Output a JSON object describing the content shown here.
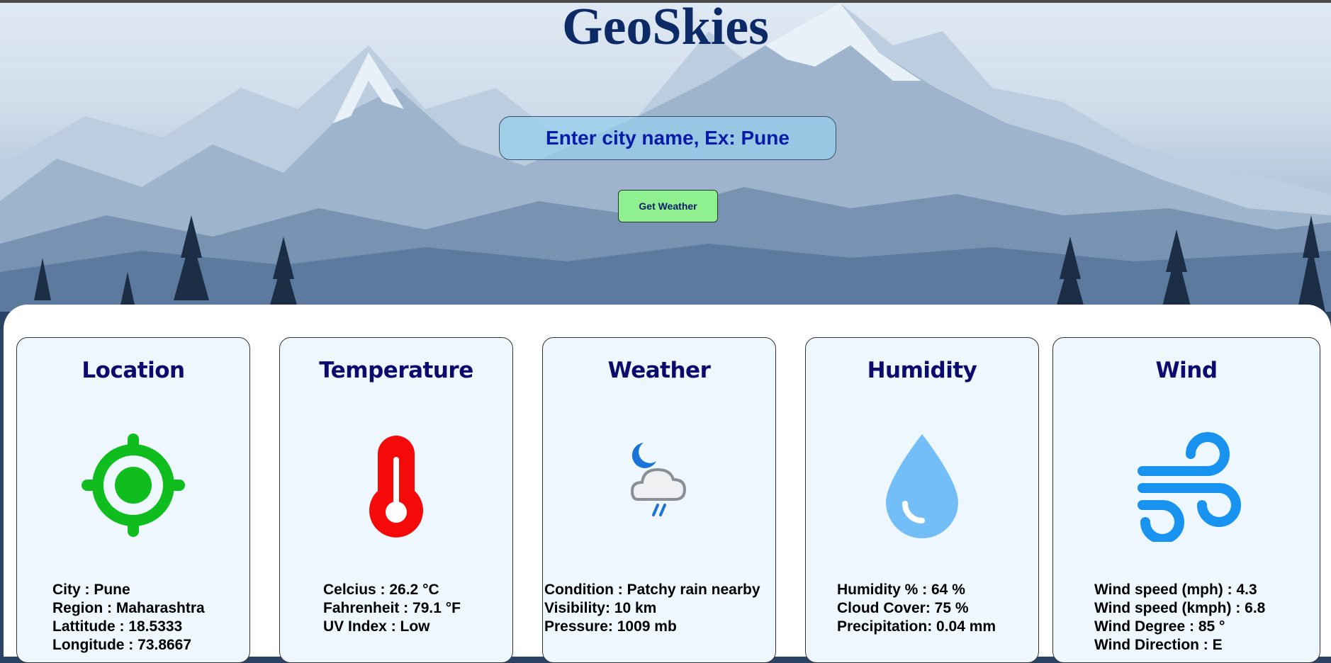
{
  "app": {
    "title": "GeoSkies"
  },
  "search": {
    "placeholder": "Enter city name, Ex: Pune",
    "button_label": "Get Weather"
  },
  "cards": {
    "location": {
      "title": "Location",
      "icon": "location-target-icon",
      "lines": [
        "City : Pune",
        "Region : Maharashtra",
        "Lattitude : 18.5333",
        "Longitude : 73.8667"
      ]
    },
    "temperature": {
      "title": "Temperature",
      "icon": "thermometer-icon",
      "lines": [
        "Celcius : 26.2 °C",
        "Fahrenheit : 79.1 °F",
        "UV Index : Low"
      ]
    },
    "weather": {
      "title": "Weather",
      "icon": "night-cloud-rain-icon",
      "lines": [
        "Condition : Patchy rain nearby",
        "Visibility: 10 km",
        "Pressure: 1009 mb"
      ]
    },
    "humidity": {
      "title": "Humidity",
      "icon": "water-drop-icon",
      "lines": [
        "Humidity % : 64 %",
        "Cloud Cover: 75 %",
        "Precipitation: 0.04 mm"
      ]
    },
    "wind": {
      "title": "Wind",
      "icon": "wind-icon",
      "lines": [
        "Wind speed (mph) : 4.3",
        "Wind speed (kmph) : 6.8",
        "Wind Degree : 85 °",
        "Wind Direction : E"
      ]
    }
  },
  "colors": {
    "title": "#0b2a66",
    "card_title": "#0b0b6e",
    "button": "#8ef08e",
    "location_icon": "#0fbe1e",
    "thermometer_icon": "#f50a0a",
    "drop_icon": "#74bef8",
    "wind_icon": "#1893f0"
  }
}
